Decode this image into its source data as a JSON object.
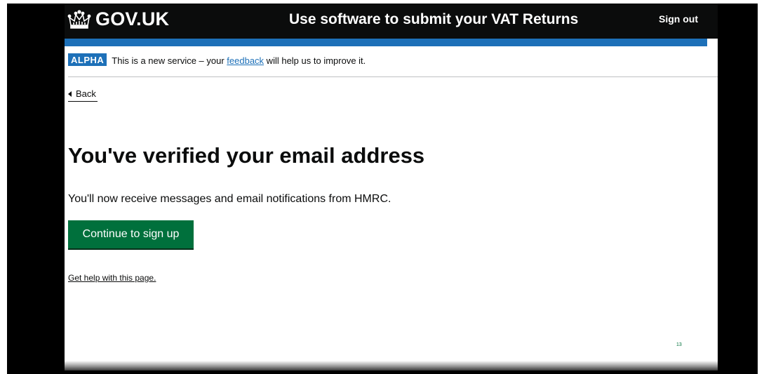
{
  "header": {
    "logo_text": "GOV.UK",
    "service_name": "Use software to submit your VAT Returns",
    "sign_out_label": "Sign out",
    "logo_icon": "crown-icon"
  },
  "phase_banner": {
    "tag": "ALPHA",
    "text_before": "This is a new service – your ",
    "feedback_link": "feedback",
    "text_after": " will help us to improve it."
  },
  "back_link": {
    "label": "Back",
    "icon": "back-arrow-icon"
  },
  "main": {
    "heading": "You've verified your email address",
    "body": "You'll now receive messages and email notifications from HMRC.",
    "continue_button": "Continue to sign up",
    "help_link": "Get help with this page."
  },
  "footer": {
    "page_number": "13"
  },
  "colors": {
    "header_background": "#0b0c0c",
    "accent_blue": "#1d70b8",
    "button_green": "#00703c",
    "text": "#0b0c0c"
  }
}
